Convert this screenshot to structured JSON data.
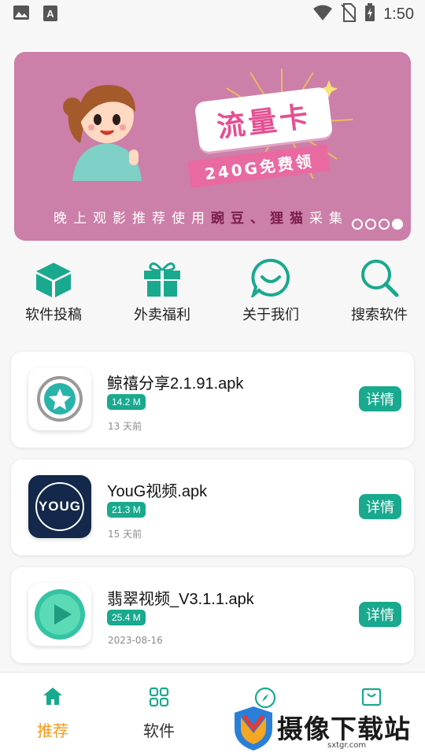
{
  "status_bar": {
    "time": "1:50",
    "icons": [
      "image-icon",
      "a-icon",
      "wifi-icon",
      "no-sim-icon",
      "battery-charging-icon"
    ]
  },
  "banner": {
    "title": "流量卡",
    "subtitle": "240G免费领",
    "caption_prefix": "晚上观影推荐使用",
    "caption_highlight": "豌豆、狸猫",
    "caption_suffix": "采集",
    "colors": {
      "background": "#cc7fa8",
      "accent": "#e64f92"
    },
    "page_dots": 4,
    "active_dot": 4
  },
  "quick_actions": [
    {
      "label": "软件投稿",
      "icon": "cube-icon"
    },
    {
      "label": "外卖福利",
      "icon": "gift-icon"
    },
    {
      "label": "关于我们",
      "icon": "chat-smile-icon"
    },
    {
      "label": "搜索软件",
      "icon": "search-icon"
    }
  ],
  "apps": [
    {
      "name": "鲸禧分享2.1.91.apk",
      "size": "14.2 M",
      "date": "13 天前",
      "button": "详情",
      "icon": "star-icon"
    },
    {
      "name": "YouG视频.apk",
      "size": "21.3 M",
      "date": "15 天前",
      "button": "详情",
      "icon": "youg-logo-icon",
      "logo_text": "YOUG"
    },
    {
      "name": "翡翠视频_V3.1.1.apk",
      "size": "25.4 M",
      "date": "2023-08-16",
      "button": "详情",
      "icon": "play-icon"
    }
  ],
  "bottom_nav": [
    {
      "label": "推荐",
      "icon": "home-icon",
      "active": true
    },
    {
      "label": "软件",
      "icon": "grid-icon",
      "active": false
    },
    {
      "label": "",
      "icon": "compass-icon",
      "active": false
    },
    {
      "label": "",
      "icon": "bag-icon",
      "active": false
    }
  ],
  "watermark": {
    "text": "摄像下载站",
    "sub": "sxtgr.com"
  },
  "accent_color": "#19a98e"
}
